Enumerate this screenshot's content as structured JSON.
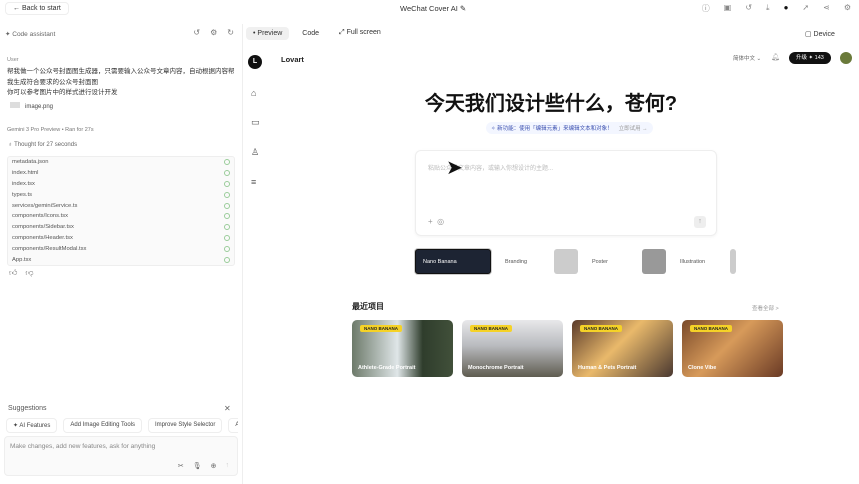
{
  "topbar": {
    "back_label": "← Back to start",
    "title": "WeChat Cover AI ✎",
    "icons": [
      "info-icon",
      "save-icon",
      "history-icon",
      "download-icon",
      "github-icon",
      "deploy-icon",
      "share-icon",
      "settings-icon"
    ]
  },
  "assistant": {
    "header": "✦ Code assistant",
    "user_label": "User",
    "message": [
      "帮我做一个公众号封面图生成器，只需要输入公众号文章内容，自动根据内容帮我生成符合要求的公众号封面图",
      "你可以参考图片中的样式进行设计开发"
    ],
    "attachment": "image.png",
    "model_meta": "Gemini 3 Pro Preview  •  Ran for 27s",
    "thought": "Thought for 27 seconds",
    "files": [
      "metadata.json",
      "index.html",
      "index.tsx",
      "types.ts",
      "services/geminiService.ts",
      "components/Icons.tsx",
      "components/Sidebar.tsx",
      "components/Header.tsx",
      "components/ResultModal.tsx",
      "App.tsx"
    ],
    "suggestions_label": "Suggestions",
    "chips": [
      "✦ AI Features",
      "Add Image Editing Tools",
      "Improve Style Selector",
      "Add"
    ],
    "input_placeholder": "Make changes, add new features, ask for anything"
  },
  "preview_tabs": [
    {
      "label": "• Preview"
    },
    {
      "label": "Code"
    },
    {
      "label": "⤢ Full screen"
    }
  ],
  "device_label": "▢ Device",
  "app": {
    "logo": "L",
    "brand": "Lovart",
    "lang": "简体中文 ⌄",
    "upgrade": "升级 ✦ 143",
    "headline": "今天我们设计些什么，苍何?",
    "banner": "✧ 新功能：使用「编辑元素」来编辑文本和对象！",
    "banner_try": "立即试用 →",
    "prompt_placeholder": "粘贴公众号文章内容，或输入你想设计的主题...",
    "styles": [
      "Nano Banana",
      "Branding",
      "Poster",
      "Illustration"
    ],
    "recent_title": "最近项目",
    "view_all": "查看全部 >",
    "projects": [
      {
        "tag": "NANO BANANA",
        "name": "Athlete-Grade Portrait"
      },
      {
        "tag": "NANO BANANA",
        "name": "Monochrome Portrait"
      },
      {
        "tag": "NANO BANANA",
        "name": "Human & Pets Portrait"
      },
      {
        "tag": "NANO BANANA",
        "name": "Clone Vibe"
      }
    ]
  }
}
